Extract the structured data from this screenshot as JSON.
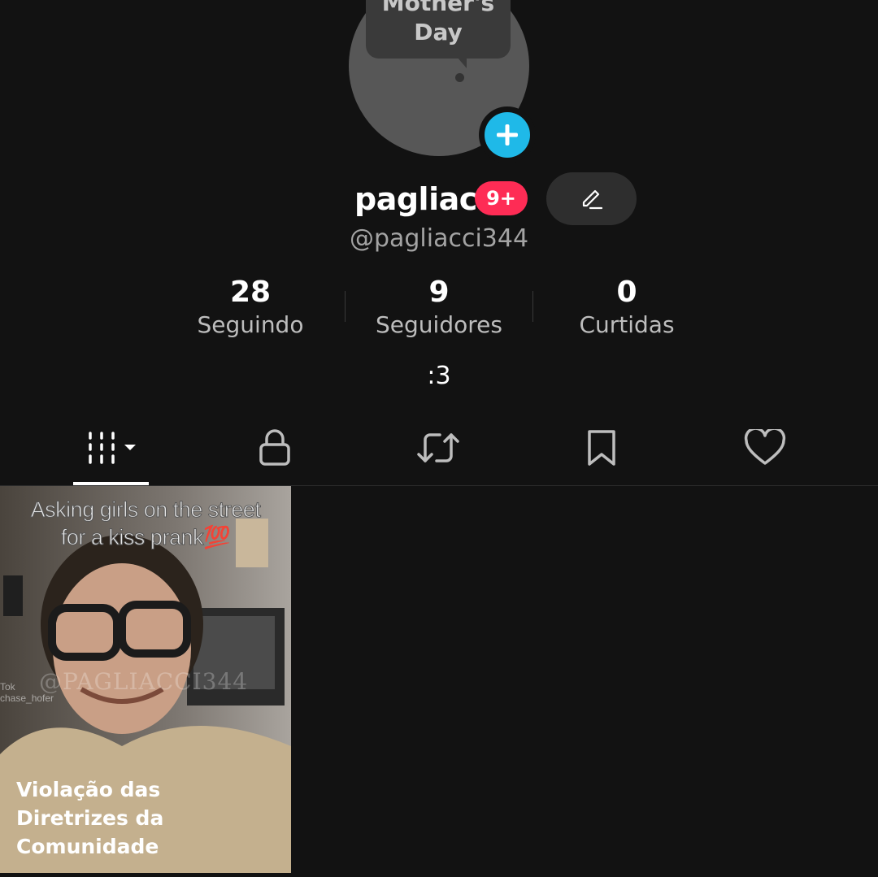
{
  "profile": {
    "story_bubble": "Mother's\nDay",
    "name": "pagliac",
    "notification_badge": "9+",
    "handle": "@pagliacci344",
    "bio": ":3"
  },
  "stats": [
    {
      "value": "28",
      "label": "Seguindo"
    },
    {
      "value": "9",
      "label": "Seguidores"
    },
    {
      "value": "0",
      "label": "Curtidas"
    }
  ],
  "tabs": [
    {
      "icon": "grid-icon",
      "active": true
    },
    {
      "icon": "lock-icon",
      "active": false
    },
    {
      "icon": "repost-icon",
      "active": false
    },
    {
      "icon": "bookmark-icon",
      "active": false
    },
    {
      "icon": "heart-icon",
      "active": false
    }
  ],
  "videos": [
    {
      "caption": "Asking girls on the street\nfor a kiss prank💯",
      "watermark": "@PAGLIACCI344",
      "corner_watermark": "Tok\nchase_hofer",
      "warning": "Violação das\nDiretrizes da\nComunidade"
    }
  ],
  "colors": {
    "background": "#121212",
    "badge": "#fe2c55",
    "add_button": "#1fb9e8"
  }
}
